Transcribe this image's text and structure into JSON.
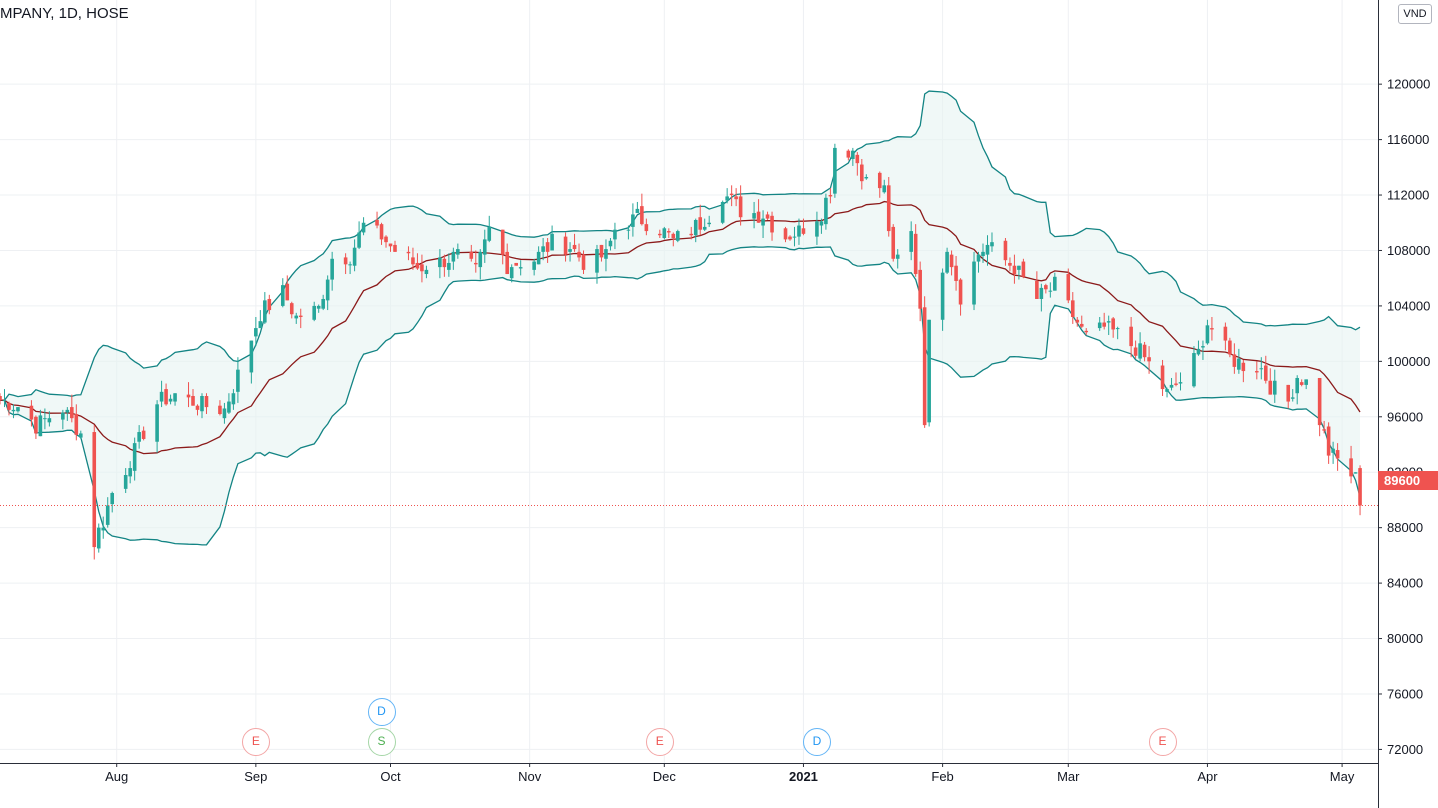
{
  "legend": {
    "symbol_text": "MPANY, 1D, HOSE"
  },
  "currency_label": "VND",
  "last_price_label": "89600",
  "colors": {
    "up": "#26a69a",
    "down": "#ef5350",
    "band": "#138484",
    "basis": "#8b1a1a",
    "band_fill": "#e6f3f2",
    "grid": "#eef0f3"
  },
  "events": [
    {
      "type": "E",
      "label": "E",
      "date": "2020-09-01"
    },
    {
      "type": "D",
      "label": "D",
      "date": "2020-09-29"
    },
    {
      "type": "S",
      "label": "S",
      "date": "2020-09-29"
    },
    {
      "type": "E",
      "label": "E",
      "date": "2020-11-30"
    },
    {
      "type": "D",
      "label": "D",
      "date": "2021-01-04"
    },
    {
      "type": "E",
      "label": "E",
      "date": "2021-03-22"
    }
  ],
  "chart_data": {
    "type": "candlestick",
    "title": "",
    "xlabel": "",
    "ylabel": "",
    "ylim": [
      69000,
      126000
    ],
    "y_ticks": [
      72000,
      76000,
      80000,
      84000,
      88000,
      92000,
      96000,
      100000,
      104000,
      108000,
      112000,
      116000,
      120000
    ],
    "y_tick_labels": [
      "72000",
      "76000",
      "80000",
      "84000",
      "88000",
      "92000",
      "96000",
      "100000",
      "104000",
      "108000",
      "112000",
      "116000",
      "120000"
    ],
    "x_range": [
      "2020-07-06",
      "2021-05-09"
    ],
    "x_ticks": [
      {
        "date": "2020-08-01",
        "label": "Aug"
      },
      {
        "date": "2020-09-01",
        "label": "Sep"
      },
      {
        "date": "2020-10-01",
        "label": "Oct"
      },
      {
        "date": "2020-11-01",
        "label": "Nov"
      },
      {
        "date": "2020-12-01",
        "label": "Dec"
      },
      {
        "date": "2021-01-01",
        "label": "2021",
        "bold": true
      },
      {
        "date": "2021-02-01",
        "label": "Feb"
      },
      {
        "date": "2021-03-01",
        "label": "Mar"
      },
      {
        "date": "2021-04-01",
        "label": "Apr"
      },
      {
        "date": "2021-05-01",
        "label": "May"
      }
    ],
    "grid": true,
    "last_price": 89600,
    "indicator": "Bollinger Bands (20, 2)",
    "price_anchors": [
      [
        "2020-07-06",
        97200
      ],
      [
        "2020-07-10",
        96800
      ],
      [
        "2020-07-14",
        95400
      ],
      [
        "2020-07-20",
        96600
      ],
      [
        "2020-07-24",
        94800
      ],
      [
        "2020-07-27",
        87000
      ],
      [
        "2020-07-29",
        88500
      ],
      [
        "2020-07-31",
        90500
      ],
      [
        "2020-08-05",
        93500
      ],
      [
        "2020-08-10",
        97000
      ],
      [
        "2020-08-14",
        97600
      ],
      [
        "2020-08-20",
        96800
      ],
      [
        "2020-08-25",
        96500
      ],
      [
        "2020-08-28",
        99000
      ],
      [
        "2020-09-02",
        103500
      ],
      [
        "2020-09-07",
        105000
      ],
      [
        "2020-09-10",
        103200
      ],
      [
        "2020-09-15",
        103800
      ],
      [
        "2020-09-18",
        107500
      ],
      [
        "2020-09-22",
        107600
      ],
      [
        "2020-09-25",
        109800
      ],
      [
        "2020-09-29",
        109000
      ],
      [
        "2020-10-02",
        108000
      ],
      [
        "2020-10-07",
        106800
      ],
      [
        "2020-10-12",
        107200
      ],
      [
        "2020-10-16",
        107600
      ],
      [
        "2020-10-20",
        106400
      ],
      [
        "2020-10-23",
        109500
      ],
      [
        "2020-10-27",
        107000
      ],
      [
        "2020-11-02",
        107300
      ],
      [
        "2020-11-06",
        108600
      ],
      [
        "2020-11-10",
        108300
      ],
      [
        "2020-11-13",
        107200
      ],
      [
        "2020-11-18",
        107600
      ],
      [
        "2020-11-20",
        109500
      ],
      [
        "2020-11-25",
        110400
      ],
      [
        "2020-11-30",
        109600
      ],
      [
        "2020-12-03",
        108700
      ],
      [
        "2020-12-08",
        109700
      ],
      [
        "2020-12-11",
        110600
      ],
      [
        "2020-12-14",
        112200
      ],
      [
        "2020-12-18",
        110900
      ],
      [
        "2020-12-23",
        110600
      ],
      [
        "2020-12-28",
        109000
      ],
      [
        "2020-12-31",
        109400
      ],
      [
        "2021-01-05",
        110800
      ],
      [
        "2021-01-07",
        112500
      ],
      [
        "2021-01-08",
        115500
      ],
      [
        "2021-01-12",
        115200
      ],
      [
        "2021-01-15",
        112900
      ],
      [
        "2021-01-19",
        112400
      ],
      [
        "2021-01-21",
        106800
      ],
      [
        "2021-01-25",
        109200
      ],
      [
        "2021-01-27",
        104000
      ],
      [
        "2021-01-28",
        96000
      ],
      [
        "2021-01-29",
        102500
      ],
      [
        "2021-02-02",
        108500
      ],
      [
        "2021-02-05",
        104800
      ],
      [
        "2021-02-09",
        107800
      ],
      [
        "2021-02-11",
        108300
      ],
      [
        "2021-02-17",
        106800
      ],
      [
        "2021-02-22",
        104500
      ],
      [
        "2021-02-26",
        105400
      ],
      [
        "2021-03-03",
        102800
      ],
      [
        "2021-03-05",
        101700
      ],
      [
        "2021-03-09",
        102400
      ],
      [
        "2021-03-12",
        101900
      ],
      [
        "2021-03-16",
        101000
      ],
      [
        "2021-03-19",
        99800
      ],
      [
        "2021-03-23",
        97600
      ],
      [
        "2021-03-26",
        98600
      ],
      [
        "2021-03-30",
        100600
      ],
      [
        "2021-04-01",
        102800
      ],
      [
        "2021-04-06",
        100300
      ],
      [
        "2021-04-09",
        99800
      ],
      [
        "2021-04-13",
        99500
      ],
      [
        "2021-04-15",
        98300
      ],
      [
        "2021-04-19",
        97100
      ],
      [
        "2021-04-21",
        99000
      ],
      [
        "2021-04-23",
        98500
      ],
      [
        "2021-04-26",
        95800
      ],
      [
        "2021-04-28",
        93500
      ],
      [
        "2021-05-04",
        91500
      ],
      [
        "2021-05-05",
        89600
      ]
    ]
  }
}
